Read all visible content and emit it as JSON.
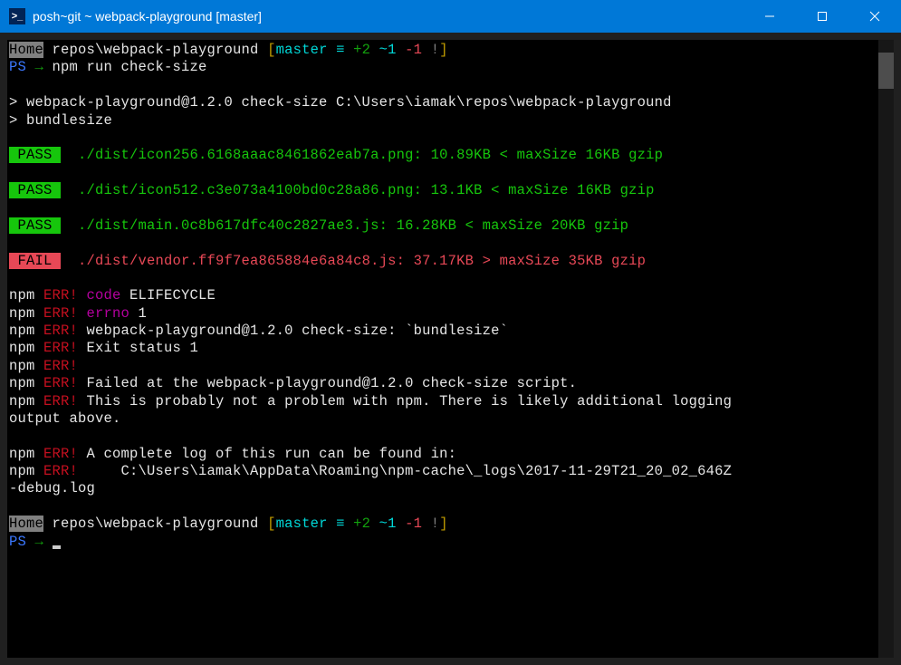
{
  "titlebar": {
    "icon_glyph": ">_",
    "title": "posh~git ~ webpack-playground [master]"
  },
  "prompt1": {
    "home": "Home",
    "path": " repos\\webpack-playground ",
    "branch_open": "[",
    "branch": "master",
    "equiv": " ≡ ",
    "ahead": "+2",
    "sep1": " ",
    "modified": "~1",
    "sep2": " ",
    "deleted": "-1",
    "excl": " !",
    "branch_close": "]"
  },
  "ps_line": {
    "ps": "PS",
    "arrow": " → ",
    "cmd": "npm run check-size"
  },
  "npm_header": {
    "line1": "> webpack-playground@1.2.0 check-size C:\\Users\\iamak\\repos\\webpack-playground",
    "line2": "> bundlesize"
  },
  "results": {
    "pass_label": " PASS ",
    "fail_label": " FAIL ",
    "r1": "  ./dist/icon256.6168aaac8461862eab7a.png: 10.89KB < maxSize 16KB gzip",
    "r2": "  ./dist/icon512.c3e073a4100bd0c28a86.png: 13.1KB < maxSize 16KB gzip",
    "r3": "  ./dist/main.0c8b617dfc40c2827ae3.js: 16.28KB < maxSize 20KB gzip",
    "r4": "  ./dist/vendor.ff9f7ea865884e6a84c8.js: 37.17KB > maxSize 35KB gzip"
  },
  "errors": {
    "npm": "npm",
    "err": " ERR!",
    "code_label": " code",
    "code_val": " ELIFECYCLE",
    "errno_label": " errno",
    "errno_val": " 1",
    "e1": " webpack-playground@1.2.0 check-size: `bundlesize`",
    "e2": " Exit status 1",
    "e3": " Failed at the webpack-playground@1.2.0 check-size script.",
    "e4": " This is probably not a problem with npm. There is likely additional logging ",
    "e4b": "output above.",
    "e5": " A complete log of this run can be found in:",
    "e6": "     C:\\Users\\iamak\\AppData\\Roaming\\npm-cache\\_logs\\2017-11-29T21_20_02_646Z",
    "e6b": "-debug.log"
  },
  "prompt2": {
    "ps": "PS",
    "arrow": " → "
  }
}
